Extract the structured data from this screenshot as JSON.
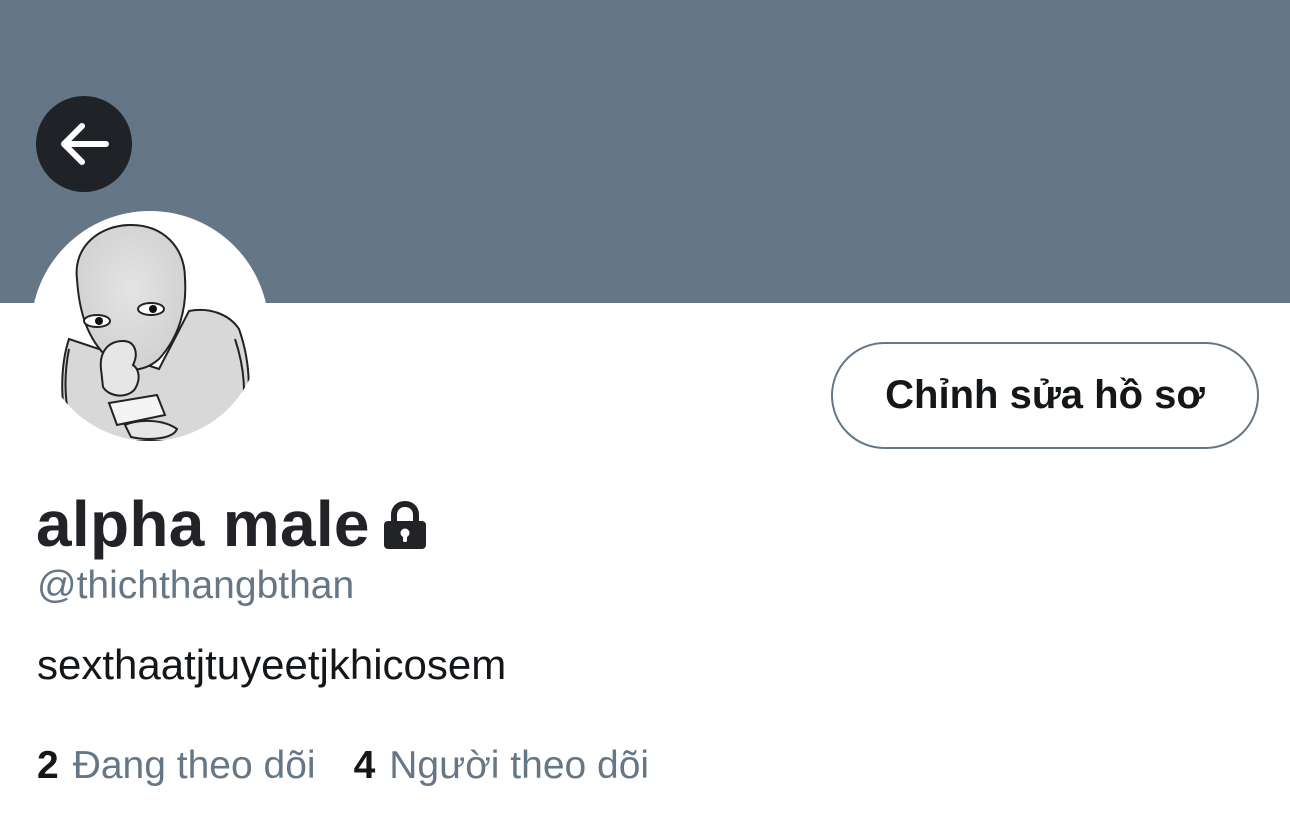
{
  "profile": {
    "display_name": "alpha male",
    "handle": "@thichthangbthan",
    "bio": "sexthaatjtuyeetjkhicosem",
    "locked": true
  },
  "actions": {
    "edit_profile_label": "Chỉnh sửa hồ sơ",
    "back_icon": "arrow-left-icon"
  },
  "stats": [
    {
      "count": "2",
      "label": "Đang theo dõi"
    },
    {
      "count": "4",
      "label": "Người theo dõi"
    }
  ],
  "colors": {
    "banner": "#657786",
    "back_button_bg": "#1f2226",
    "primary_text": "#14171a",
    "secondary_text": "#657786",
    "button_border": "#657786"
  }
}
